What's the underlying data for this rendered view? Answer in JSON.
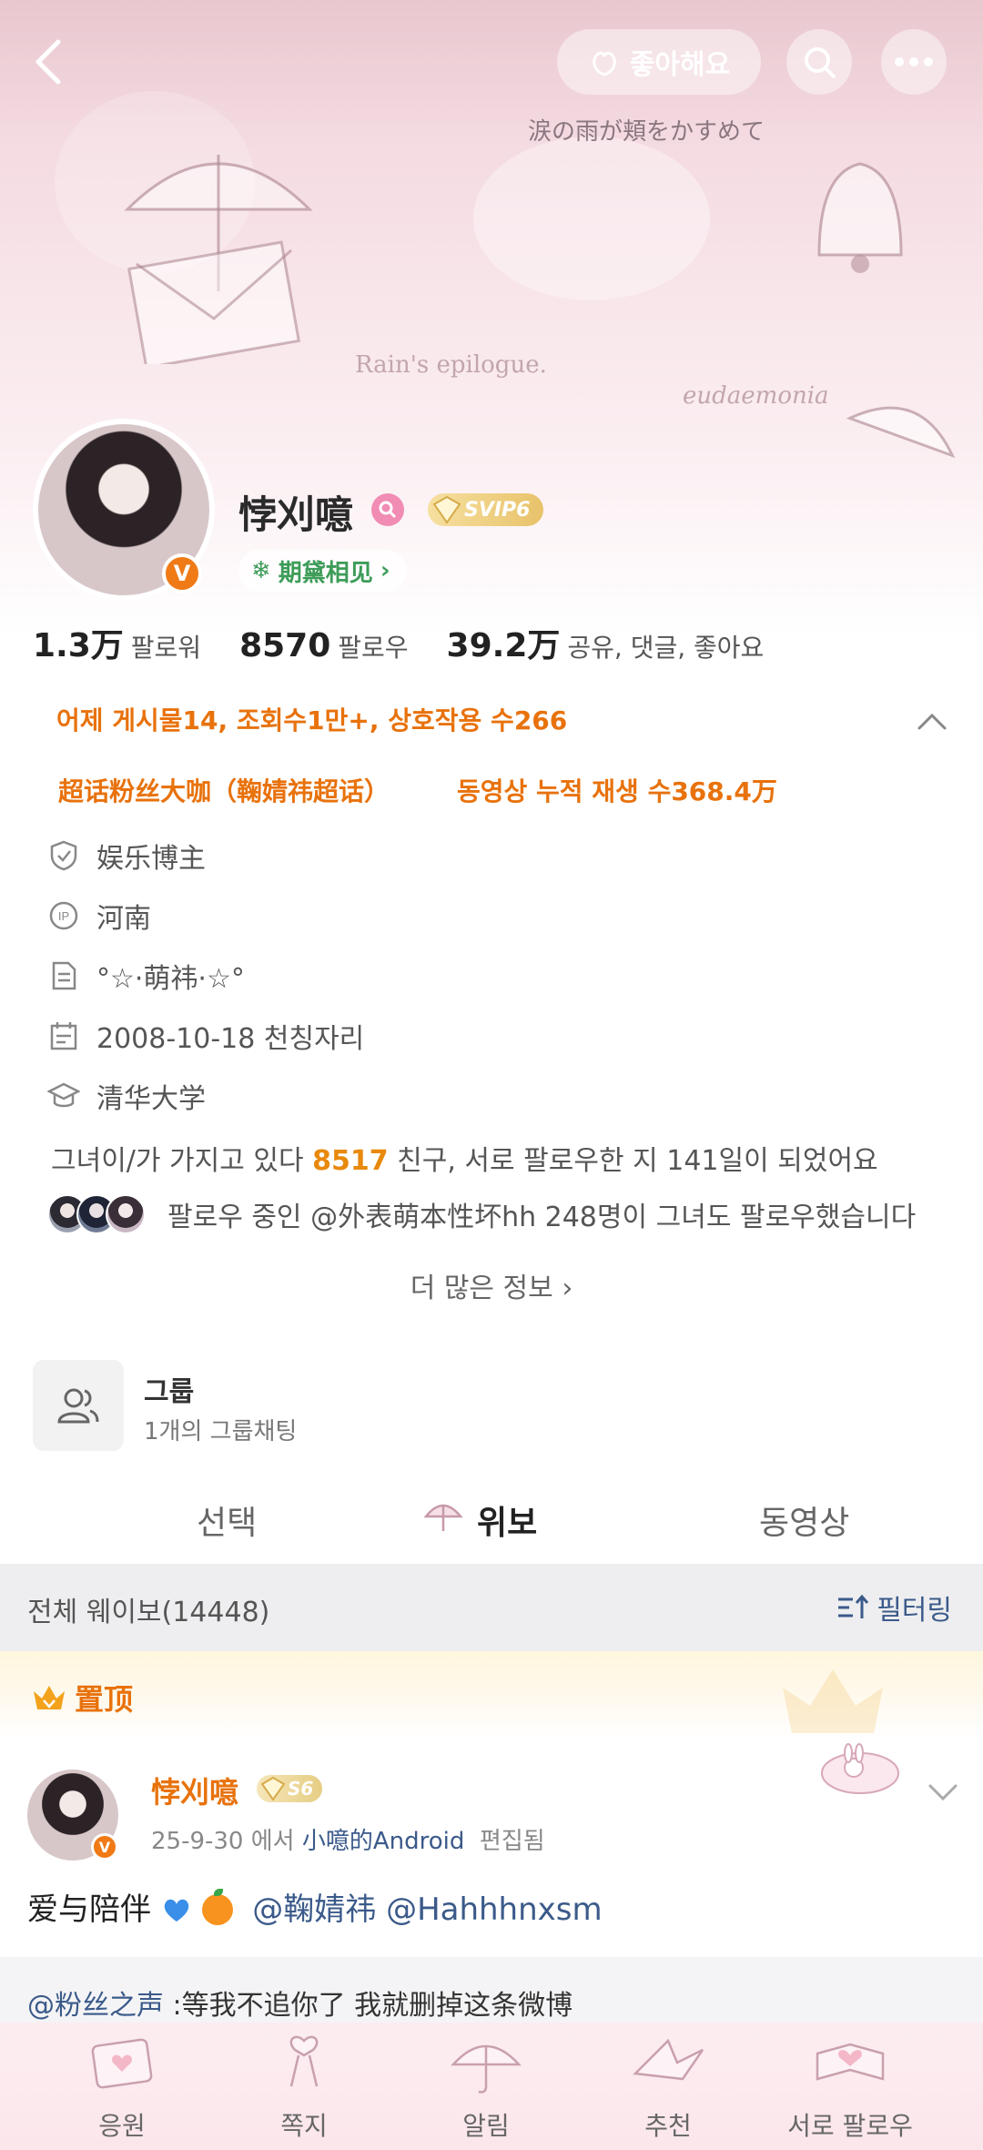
{
  "header": {
    "like_label": "좋아해요",
    "banner_lines": [
      "涙の雨が頬をかすめて",
      "Rain's epilogue.",
      "eudaemonia"
    ]
  },
  "profile": {
    "name": "悖刈噫",
    "svip_label": "SVIP6",
    "chaohua_label": "期黛相见",
    "verified_badge": "V"
  },
  "stats": [
    {
      "num": "1.3万",
      "label": "팔로워"
    },
    {
      "num": "8570",
      "label": "팔로우"
    },
    {
      "num": "39.2万",
      "label": "공유, 댓글, 좋아요"
    }
  ],
  "highlights": {
    "line1": "어제 게시물14, 조회수1만+, 상호작용 수266",
    "line2a": "超话粉丝大咖（鞠婧祎超话）",
    "line2b": "동영상 누적 재생 수368.4万"
  },
  "info": [
    {
      "icon": "shield-check-icon",
      "value": "娱乐博主"
    },
    {
      "icon": "ip-location-icon",
      "value": "河南"
    },
    {
      "icon": "bio-document-icon",
      "value": "°☆·萌祎·☆°"
    },
    {
      "icon": "calendar-icon",
      "value": "2008-10-18 천칭자리"
    },
    {
      "icon": "graduation-cap-icon",
      "value": "清华大学"
    }
  ],
  "friends": {
    "prefix": "그녀이/가 가지고 있다 ",
    "count": "8517",
    "suffix": " 친구, 서로 팔로우한 지 141일이 되었어요"
  },
  "mutual": {
    "text": "팔로우 중인 @外表萌本性坏hh 248명이 그녀도 팔로우했습니다"
  },
  "more_info": "더 많은 정보",
  "group": {
    "title": "그룹",
    "subtitle": "1개의 그룹채팅"
  },
  "tabs": [
    {
      "label": "선택",
      "active": false
    },
    {
      "label": "위보",
      "active": true
    },
    {
      "label": "동영상",
      "active": false
    }
  ],
  "feed": {
    "title": "전체 웨이보(14448)",
    "filter_label": "필터링",
    "pinned_label": "置顶"
  },
  "post": {
    "author": "悖刈噫",
    "level": "S6",
    "date": "25-9-30",
    "via": " 에서 ",
    "source": "小噫的Android",
    "edited": "편집됨",
    "text_plain": "爱与陪伴",
    "mention1": "@鞠婧祎",
    "mention2": "@Hahhhnxsm"
  },
  "quote": {
    "mention": "@粉丝之声",
    "text": " :等我不追你了 我就删掉这条微博"
  },
  "bottom_nav": [
    {
      "label": "응원"
    },
    {
      "label": "쪽지"
    },
    {
      "label": "알림"
    },
    {
      "label": "추천"
    },
    {
      "label": "서로 팔로우"
    }
  ],
  "colors": {
    "accent_orange": "#e8720c",
    "link_blue": "#3b5a8a",
    "chaohua_green": "#3d9c58",
    "banner_pink": "#f4dbe1"
  }
}
